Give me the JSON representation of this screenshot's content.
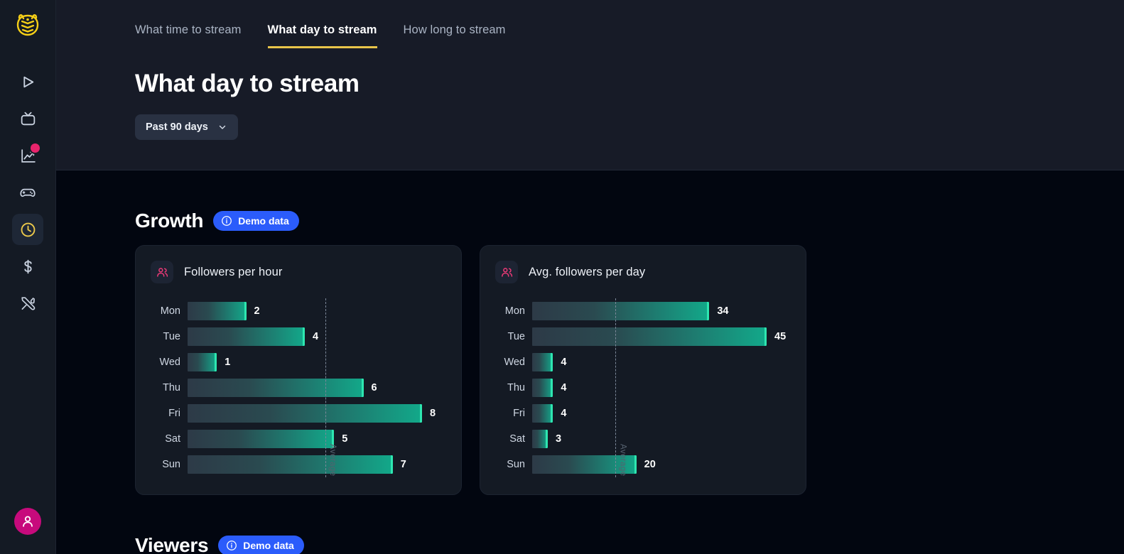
{
  "sidebar": {
    "logo_name": "owl-shield-logo",
    "items": [
      {
        "name": "play-icon",
        "label": "Stream",
        "active": false,
        "badge": false
      },
      {
        "name": "tv-icon",
        "label": "Channel",
        "active": false,
        "badge": false
      },
      {
        "name": "trending-chart-icon",
        "label": "Analytics",
        "active": false,
        "badge": true
      },
      {
        "name": "gamepad-icon",
        "label": "Games",
        "active": false,
        "badge": false
      },
      {
        "name": "clock-icon",
        "label": "Schedule",
        "active": true,
        "badge": false
      },
      {
        "name": "dollar-icon",
        "label": "Revenue",
        "active": false,
        "badge": false
      },
      {
        "name": "tools-icon",
        "label": "Tools",
        "active": false,
        "badge": false
      }
    ],
    "avatar_name": "user-avatar"
  },
  "header": {
    "tabs": [
      {
        "label": "What time to stream",
        "active": false
      },
      {
        "label": "What day to stream",
        "active": true
      },
      {
        "label": "How long to stream",
        "active": false
      }
    ],
    "page_title": "What day to stream",
    "range_selector": {
      "value": "Past 90 days",
      "chevron": "chevron-down-icon"
    }
  },
  "sections": [
    {
      "title": "Growth",
      "badge": "Demo data"
    },
    {
      "title": "Viewers",
      "badge": "Demo data"
    }
  ],
  "colors": {
    "accent_yellow": "#e8c44a",
    "badge_blue": "#2b5cfb",
    "bar_teal": "#12a98a",
    "bar_cap": "#2ee6b0",
    "pink_icon": "#ef3a78",
    "avatar_magenta": "#c70a7c",
    "card_bg": "#141a24",
    "page_bg": "#020610",
    "header_bg": "#171b27"
  },
  "chart_data": [
    {
      "type": "bar",
      "orientation": "horizontal",
      "title": "Followers per hour",
      "icon": "users-icon",
      "xlabel": "",
      "ylabel": "",
      "categories": [
        "Mon",
        "Tue",
        "Wed",
        "Thu",
        "Fri",
        "Sat",
        "Sun"
      ],
      "values": [
        2,
        4,
        1,
        6,
        8,
        5,
        7
      ],
      "xlim": [
        0,
        8
      ],
      "grid": false,
      "legend": "none",
      "annotations": [
        {
          "type": "average-line",
          "label": "Average",
          "value": 4.7,
          "style": "dashed-vertical"
        }
      ]
    },
    {
      "type": "bar",
      "orientation": "horizontal",
      "title": "Avg. followers per day",
      "icon": "users-icon",
      "xlabel": "",
      "ylabel": "",
      "categories": [
        "Mon",
        "Tue",
        "Wed",
        "Thu",
        "Fri",
        "Sat",
        "Sun"
      ],
      "values": [
        34,
        45,
        4,
        4,
        4,
        3,
        20
      ],
      "xlim": [
        0,
        45
      ],
      "grid": false,
      "legend": "none",
      "annotations": [
        {
          "type": "average-line",
          "label": "Average",
          "value": 16,
          "style": "dashed-vertical"
        }
      ]
    }
  ]
}
